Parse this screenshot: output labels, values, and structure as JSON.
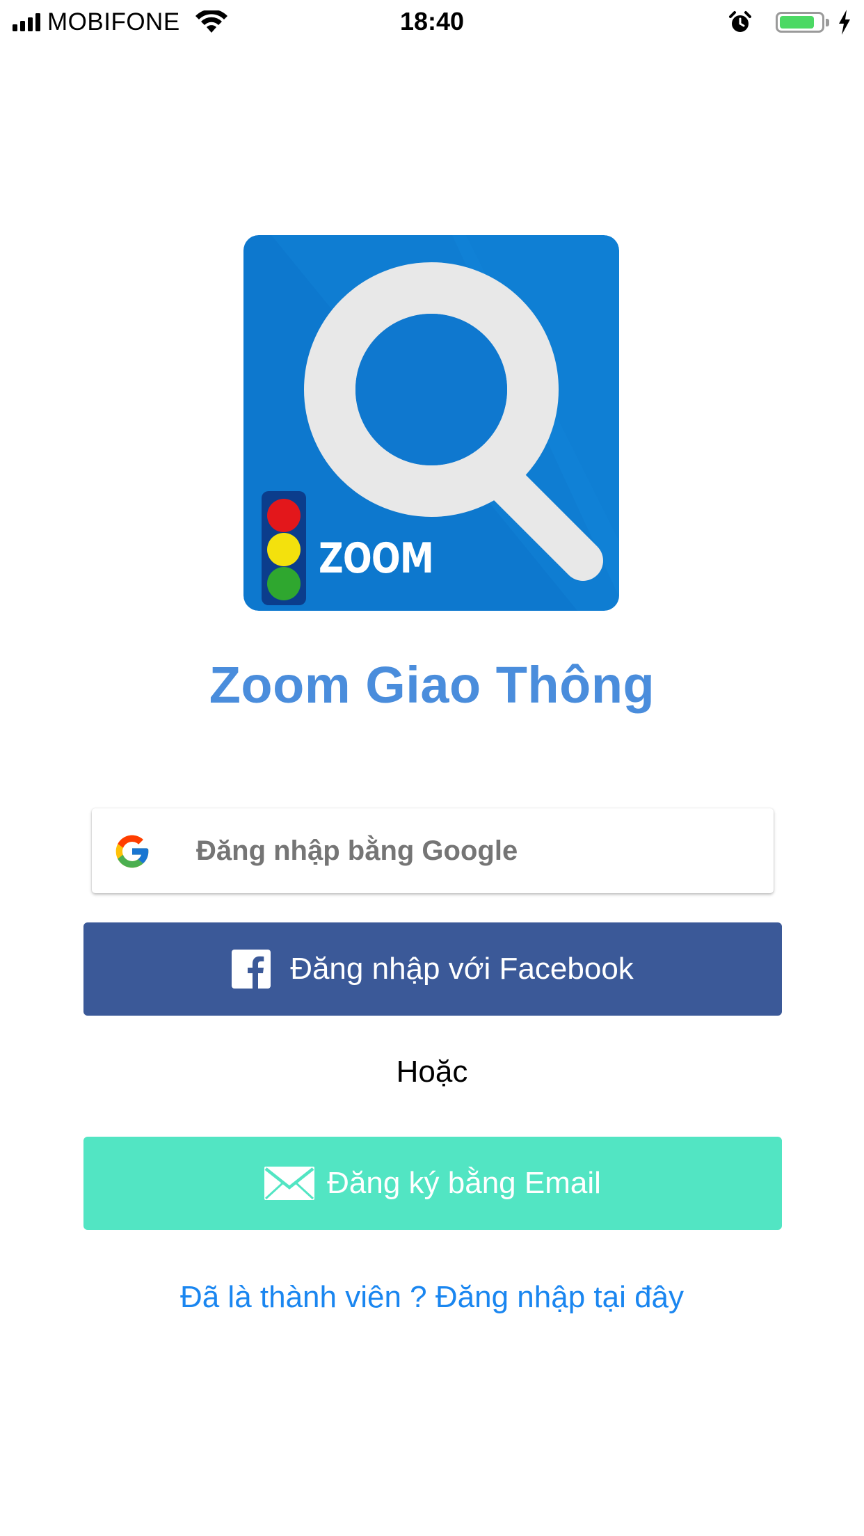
{
  "status_bar": {
    "carrier": "MOBIFONE",
    "time": "18:40",
    "battery_level": 0.85,
    "icons": [
      "signal-icon",
      "wifi-icon",
      "alarm-icon",
      "battery-icon",
      "charging-icon"
    ]
  },
  "logo": {
    "badge_text": "ZOOM",
    "icon": "magnifier-traffic-light-logo"
  },
  "app": {
    "title": "Zoom Giao Thông"
  },
  "google_button": {
    "label": "Đăng nhập bằng Google",
    "icon": "google-icon"
  },
  "facebook_button": {
    "label": "Đăng nhập với Facebook",
    "icon": "facebook-icon"
  },
  "divider": {
    "text": "Hoặc"
  },
  "email_button": {
    "label": "Đăng ký bằng Email",
    "icon": "mail-icon"
  },
  "login_link": {
    "text": "Đã là thành viên ? Đăng nhập tại đây"
  },
  "colors": {
    "title": "#4a8ddc",
    "facebook": "#3b5998",
    "email": "#52e5c3",
    "link": "#1a86f0",
    "logo_blue": "#0f7fd4"
  }
}
